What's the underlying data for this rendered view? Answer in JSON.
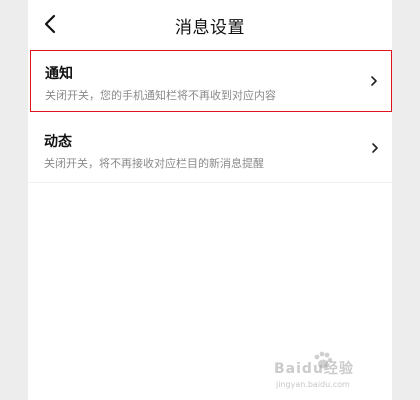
{
  "header": {
    "title": "消息设置"
  },
  "items": [
    {
      "title": "通知",
      "description": "关闭开关，您的手机通知栏将不再收到对应内容"
    },
    {
      "title": "动态",
      "description": "关闭开关，将不再接收对应栏目的新消息提醒"
    }
  ],
  "watermark": {
    "brand": "Baidu经验",
    "url": "jingyan.baidu.com"
  },
  "colors": {
    "background": "#ededed",
    "surface": "#ffffff",
    "highlight_border": "#e0121f",
    "secondary_text": "#8a8a8a"
  }
}
